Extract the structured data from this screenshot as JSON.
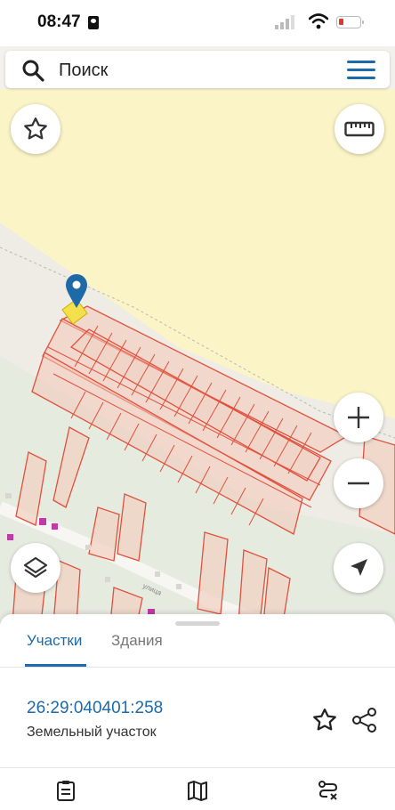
{
  "status": {
    "time": "08:47"
  },
  "search": {
    "placeholder": "Поиск"
  },
  "icons": {
    "search": "search-icon",
    "menu": "menu-icon",
    "favorite": "star-icon",
    "ruler": "ruler-icon",
    "zoom_in": "plus-icon",
    "zoom_out": "minus-icon",
    "layers": "layers-icon",
    "locate": "navigation-arrow-icon",
    "pin": "location-pin-icon",
    "share": "share-icon"
  },
  "colors": {
    "accent": "#1e6aa8",
    "parcel_stroke": "#e0513d",
    "parcel_fill": "#f3c7b8",
    "selected": "#f4e04d"
  },
  "sheet": {
    "tabs": [
      {
        "label": "Участки",
        "active": true
      },
      {
        "label": "Здания",
        "active": false
      }
    ],
    "parcel": {
      "cadastral_number": "26:29:040401:258",
      "type": "Земельный участок"
    }
  }
}
